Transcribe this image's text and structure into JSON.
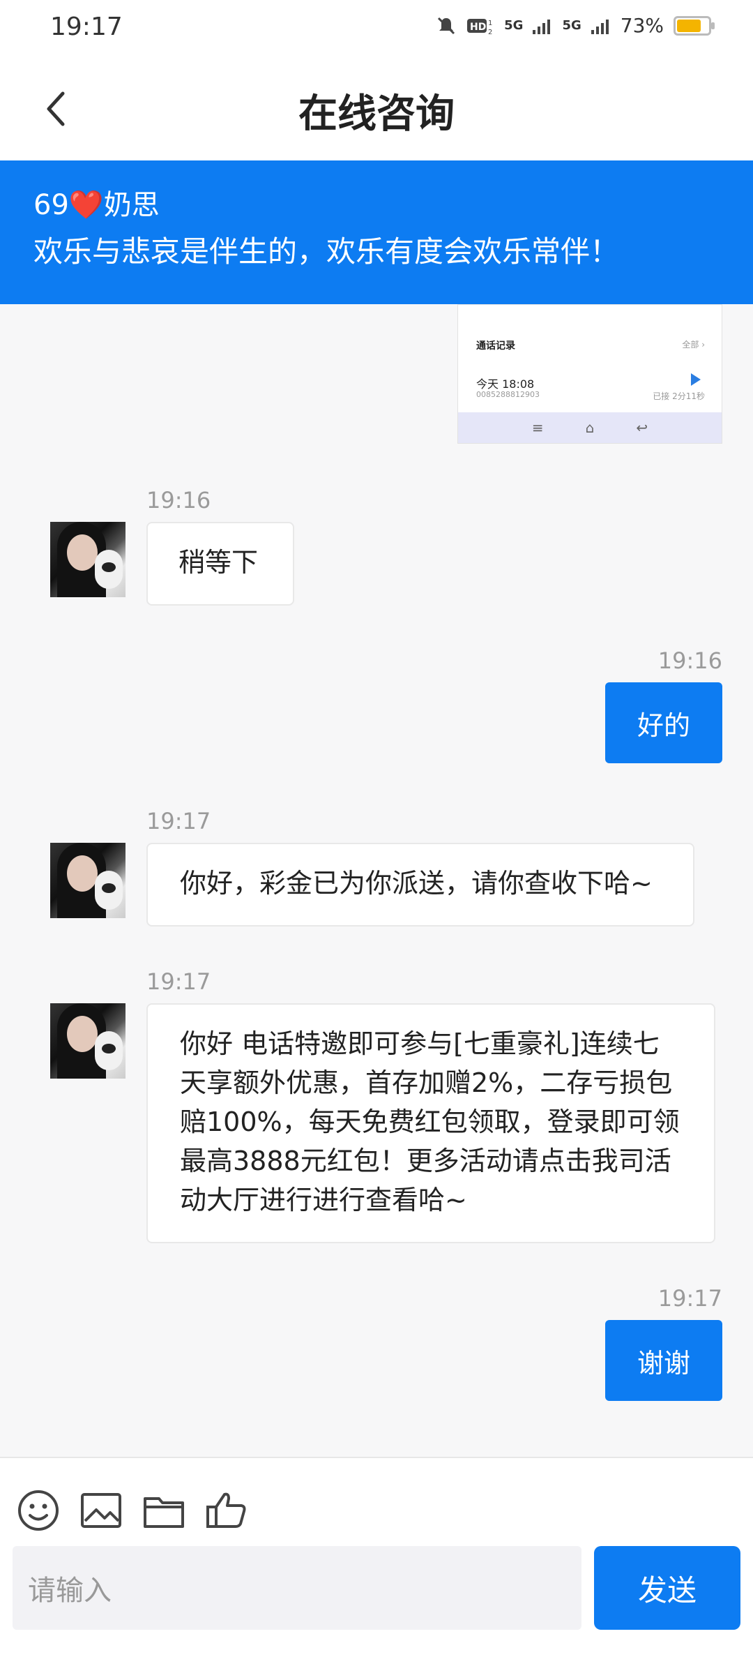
{
  "status_bar": {
    "time": "19:17",
    "network_1": "5G",
    "network_2": "5G",
    "battery_percent": "73%",
    "battery_level": 0.73
  },
  "header": {
    "title": "在线咨询"
  },
  "banner": {
    "name": "69❤️奶思",
    "motto": "欢乐与悲哀是伴生的，欢乐有度会欢乐常伴！"
  },
  "screenshot_preview": {
    "title": "通话记录",
    "all_label": "全部 ›",
    "date": "今天 18:08",
    "number": "0085288812903",
    "duration": "已接 2分11秒"
  },
  "messages": [
    {
      "time": "19:16",
      "text": "稍等下"
    },
    {
      "time": "19:16",
      "text": "好的"
    },
    {
      "time": "19:17",
      "text": "你好，彩金已为你派送，请你查收下哈~"
    },
    {
      "time": "19:17",
      "text": "你好 电话特邀即可参与[七重豪礼]连续七天享额外优惠，首存加赠2%，二存亏损包赔100%，每天免费红包领取，登录即可领最高3888元红包！更多活动请点击我司活动大厅进行进行查看哈~"
    },
    {
      "time": "19:17",
      "text": "谢谢"
    }
  ],
  "composer": {
    "placeholder": "请输入",
    "send_label": "发送"
  }
}
